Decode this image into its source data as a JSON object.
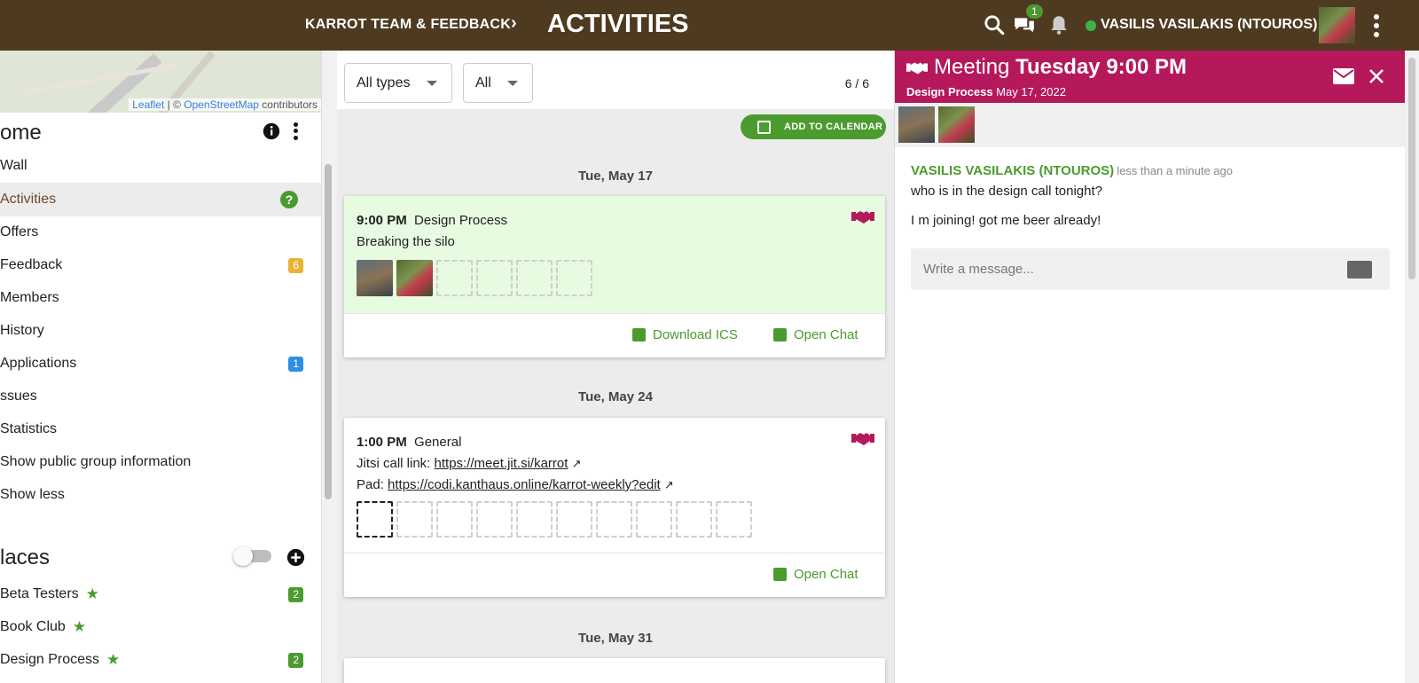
{
  "header": {
    "group_name": "KARROT TEAM & FEEDBACK",
    "separator": "›",
    "page_title": "ACTIVITIES",
    "chat_badge": "1",
    "user_name": "VASILIS VASILAKIS (NTOUROS)"
  },
  "map": {
    "attribution_leaflet": "Leaflet",
    "attribution_sep": " | © ",
    "attribution_osm": "OpenStreetMap",
    "attribution_tail": " contributors"
  },
  "sidebar": {
    "home_title": "ome",
    "items": [
      {
        "label": "Wall"
      },
      {
        "label": "Activities",
        "badge": "?"
      },
      {
        "label": "Offers"
      },
      {
        "label": "Feedback",
        "badge": "6"
      },
      {
        "label": "Members"
      },
      {
        "label": "History"
      },
      {
        "label": "Applications",
        "badge": "1"
      },
      {
        "label": "ssues"
      },
      {
        "label": "Statistics"
      },
      {
        "label": "Show public group information"
      },
      {
        "label": "Show less"
      }
    ],
    "places_title": "laces",
    "places": [
      {
        "label": "Beta Testers",
        "badge": "2"
      },
      {
        "label": "Book Club"
      },
      {
        "label": "Design Process",
        "badge": "2"
      }
    ]
  },
  "filters": {
    "type_select": "All types",
    "status_select": "All",
    "counter": "6 / 6",
    "add_calendar": "ADD TO CALENDAR"
  },
  "activities": [
    {
      "date": "Tue, May 17",
      "time": "9:00 PM",
      "place": "Design Process",
      "description": "Breaking the silo",
      "download_ics": "Download ICS",
      "open_chat": "Open Chat"
    },
    {
      "date": "Tue, May 24",
      "time": "1:00 PM",
      "place": "General",
      "jitsi_label": "Jitsi call link: ",
      "jitsi_url": "https://meet.jit.si/karrot",
      "pad_label": "Pad: ",
      "pad_url": "https://codi.kanthaus.online/karrot-weekly?edit",
      "open_chat": "Open Chat"
    },
    {
      "date": "Tue, May 31"
    }
  ],
  "chat": {
    "title_prefix": "Meeting",
    "title_time": "Tuesday 9:00 PM",
    "place": "Design Process",
    "date": "May 17, 2022",
    "author": "VASILIS VASILAKIS (NTOUROS)",
    "time_ago": "less than a minute ago",
    "messages": [
      "who is in the design call tonight?",
      "I m joining! got me beer already!"
    ],
    "input_placeholder": "Write a message..."
  },
  "colors": {
    "topbar": "#4e3a20",
    "accent_green": "#4b9b2f",
    "meeting_magenta": "#b5195b",
    "badge_yellow": "#e8b339",
    "badge_blue": "#2d8fe0"
  }
}
